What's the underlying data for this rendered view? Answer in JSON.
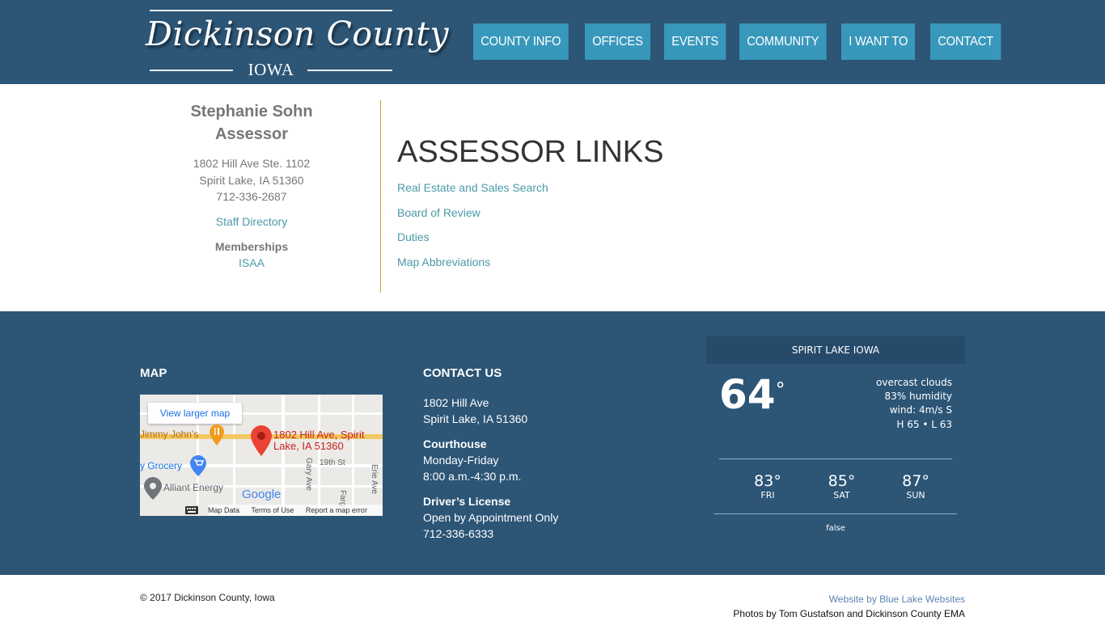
{
  "header": {
    "logo_title": "Dickinson County",
    "logo_subtitle": "IOWA",
    "nav": [
      "COUNTY INFO",
      "OFFICES",
      "EVENTS",
      "COMMUNITY",
      "I WANT TO",
      "CONTACT"
    ]
  },
  "sidebar": {
    "name": "Stephanie Sohn",
    "role": "Assessor",
    "address_line1": "1802 Hill Ave Ste. 1102",
    "address_line2": "Spirit Lake, IA 51360",
    "phone": "712-336-2687",
    "staff_link": "Staff Directory",
    "memberships_heading": "Memberships",
    "membership_link": "ISAA"
  },
  "content": {
    "heading": "ASSESSOR LINKS",
    "links": [
      "Real Estate and Sales Search",
      "Board of Review",
      "Duties",
      "Map Abbreviations"
    ]
  },
  "footer": {
    "map_heading": "MAP",
    "map": {
      "view_larger": "View larger map",
      "pin_label_1": "1802 Hill Ave, Spirit",
      "pin_label_2": "Lake, IA 51360",
      "poi_1": "Jimmy John's",
      "poi_2": "y Grocery",
      "poi_3": "Alliant Energy",
      "street_1": "19th St",
      "street_2": "Gary Ave",
      "street_3": "Erie Ave",
      "street_4": "Farg",
      "google": "Google",
      "attrib_data": "Map Data",
      "attrib_terms": "Terms of Use",
      "attrib_report": "Report a map error"
    },
    "contact_heading": "CONTACT US",
    "contact": {
      "address_line1": "1802 Hill Ave",
      "address_line2": "Spirit Lake, IA 51360",
      "courthouse_label": "Courthouse",
      "courthouse_days": "Monday-Friday",
      "courthouse_hours": "8:00 a.m.-4:30 p.m.",
      "license_label": "Driver’s License",
      "license_note": "Open by Appointment Only",
      "license_phone": "712-336-6333"
    },
    "weather": {
      "location": "SPIRIT LAKE IOWA",
      "temp": "64",
      "degree": "°",
      "conditions": "overcast clouds",
      "humidity": "83% humidity",
      "wind": "wind: 4m/s S",
      "hilo": "H 65 • L 63",
      "forecast": [
        {
          "temp": "83°",
          "day": "FRI"
        },
        {
          "temp": "85°",
          "day": "SAT"
        },
        {
          "temp": "87°",
          "day": "SUN"
        }
      ],
      "note": "false"
    }
  },
  "bottom": {
    "copyright": "© 2017 Dickinson County, Iowa",
    "website_credit": "Website by Blue Lake Websites",
    "photo_credit": "Photos by Tom Gustafson and Dickinson County EMA"
  },
  "colors": {
    "header_bg": "#2c5576",
    "nav_bg": "#3898bb",
    "link": "#4a9aa9",
    "divider": "#c7a23c"
  }
}
